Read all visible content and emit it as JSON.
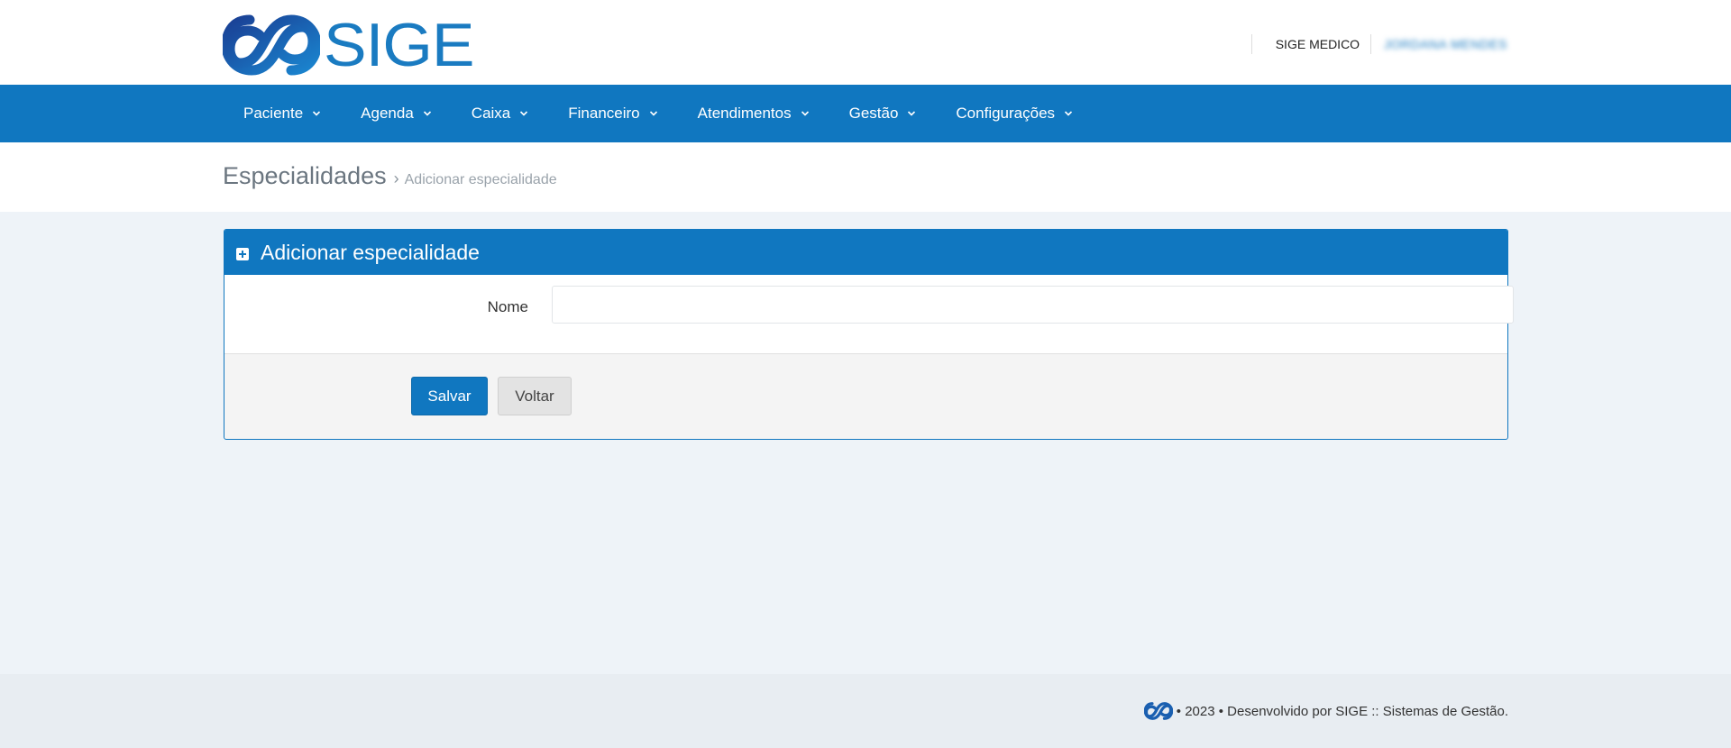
{
  "header": {
    "logo_text": "SIGE",
    "system_name": "SIGE MEDICO",
    "user_name": "JORDANA MENDES"
  },
  "nav": {
    "items": [
      {
        "label": "Paciente"
      },
      {
        "label": "Agenda"
      },
      {
        "label": "Caixa"
      },
      {
        "label": "Financeiro"
      },
      {
        "label": "Atendimentos"
      },
      {
        "label": "Gestão"
      },
      {
        "label": "Configurações"
      }
    ]
  },
  "breadcrumb": {
    "title": "Especialidades",
    "separator": "›",
    "current": "Adicionar especialidade"
  },
  "panel": {
    "title": "Adicionar especialidade",
    "field_label": "Nome",
    "field_value": "",
    "field_placeholder": "",
    "save_label": "Salvar",
    "back_label": "Voltar"
  },
  "footer": {
    "text": "• 2023 • Desenvolvido por SIGE :: Sistemas de Gestão."
  },
  "colors": {
    "primary": "#1077c0",
    "background": "#eef3f8"
  }
}
